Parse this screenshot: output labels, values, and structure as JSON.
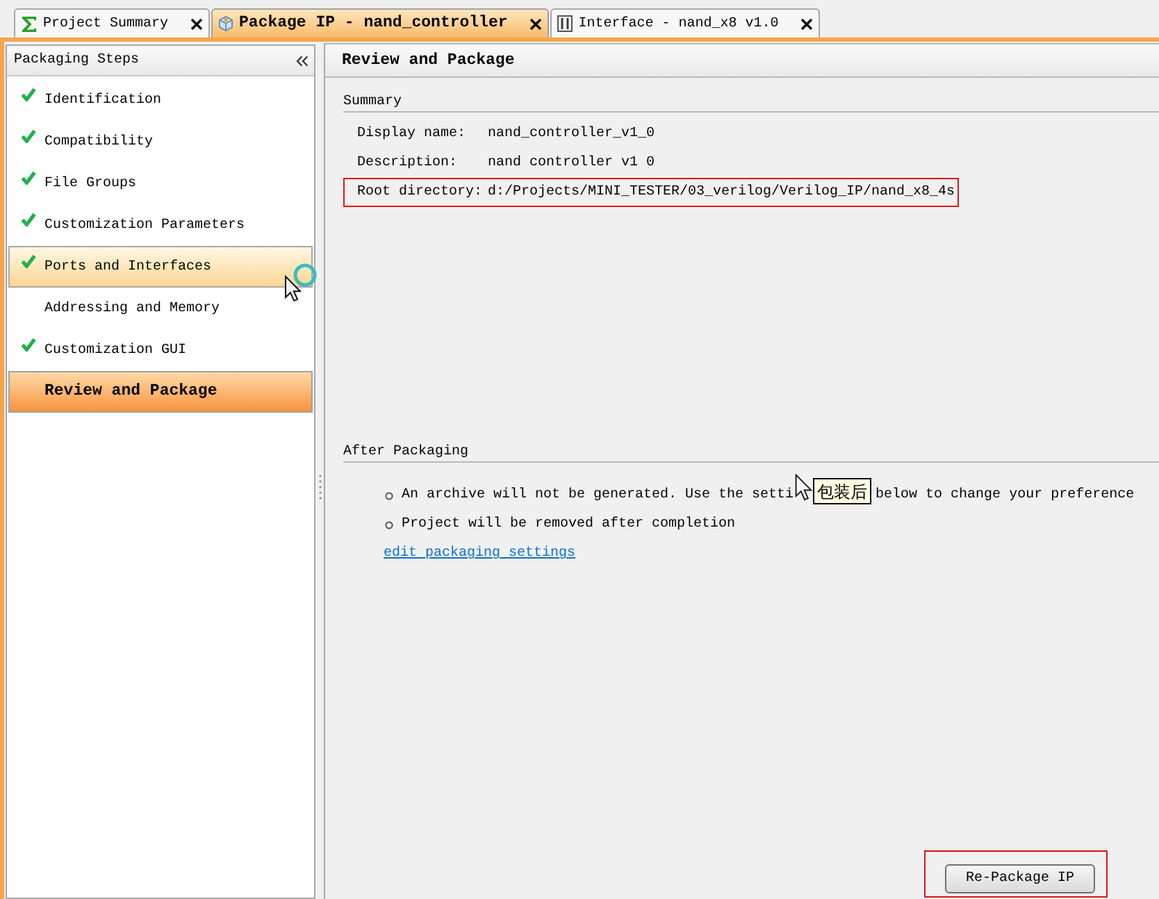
{
  "tabs": [
    {
      "kind": "summary",
      "label": "Project Summary",
      "selected": false
    },
    {
      "kind": "package",
      "label": "Package IP - nand_controller",
      "selected": true
    },
    {
      "kind": "interface",
      "label": "Interface - nand_x8 v1.0",
      "selected": false
    }
  ],
  "steps_panel": {
    "title": "Packaging Steps",
    "steps": [
      {
        "label": "Identification",
        "done": true,
        "hovered": false,
        "selected": false
      },
      {
        "label": "Compatibility",
        "done": true,
        "hovered": false,
        "selected": false
      },
      {
        "label": "File Groups",
        "done": true,
        "hovered": false,
        "selected": false
      },
      {
        "label": "Customization Parameters",
        "done": true,
        "hovered": false,
        "selected": false
      },
      {
        "label": "Ports and Interfaces",
        "done": true,
        "hovered": true,
        "selected": false
      },
      {
        "label": "Addressing and Memory",
        "done": false,
        "hovered": false,
        "selected": false
      },
      {
        "label": "Customization GUI",
        "done": true,
        "hovered": false,
        "selected": false
      },
      {
        "label": "Review and Package",
        "done": false,
        "hovered": false,
        "selected": true
      }
    ]
  },
  "review": {
    "title": "Review and Package",
    "summary": {
      "title": "Summary",
      "fields": [
        {
          "label": "Display name:",
          "value": "nand_controller_v1_0",
          "highlighted": false
        },
        {
          "label": "Description:",
          "value": "nand controller v1 0",
          "highlighted": false
        },
        {
          "label": "Root directory:",
          "value": "d:/Projects/MINI_TESTER/03_verilog/Verilog_IP/nand_x8_4s",
          "highlighted": true
        }
      ]
    },
    "after_packaging": {
      "title": "After Packaging",
      "notes": [
        {
          "parts": [
            "An archive will not be generated. Use the setti",
            "below to change your preference"
          ],
          "tooltip": "包装后"
        },
        {
          "parts": [
            "Project will be removed after completion"
          ]
        }
      ],
      "link": "edit packaging settings"
    },
    "button": {
      "label": "Re-Package IP",
      "highlighted": true
    }
  }
}
